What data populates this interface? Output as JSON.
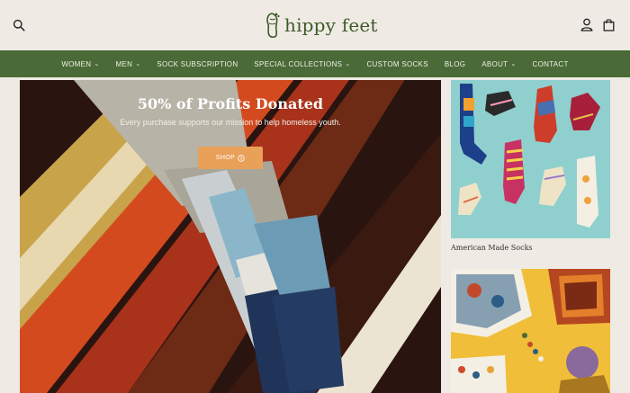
{
  "header": {
    "brand": "hippy feet",
    "search_icon": "search-icon",
    "account_icon": "user-icon",
    "cart_icon": "shopping-bag-icon"
  },
  "nav": {
    "items": [
      {
        "label": "WOMEN",
        "has_dropdown": true
      },
      {
        "label": "MEN",
        "has_dropdown": true
      },
      {
        "label": "SOCK SUBSCRIPTION",
        "has_dropdown": false
      },
      {
        "label": "SPECIAL COLLECTIONS",
        "has_dropdown": true
      },
      {
        "label": "CUSTOM SOCKS",
        "has_dropdown": false
      },
      {
        "label": "BLOG",
        "has_dropdown": false
      },
      {
        "label": "ABOUT",
        "has_dropdown": true
      },
      {
        "label": "CONTACT",
        "has_dropdown": false
      }
    ]
  },
  "hero": {
    "title": "50% of Profits Donated",
    "subtitle": "Every purchase supports our mission to help homeless youth.",
    "button_label": "SHOP",
    "button_icon": "arrow-circle-icon"
  },
  "side": {
    "card1_label": "American Made Socks"
  },
  "colors": {
    "background": "#efebe4",
    "nav": "#4a6b37",
    "brand": "#3d5a2a",
    "cta": "#e9a058"
  }
}
